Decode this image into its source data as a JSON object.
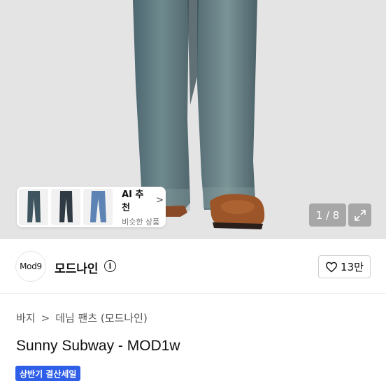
{
  "hero": {
    "image_desc_icon": "jeans-photo",
    "counter": "1 / 8"
  },
  "ai_card": {
    "title": "AI 추천",
    "subtitle": "비슷한 상품",
    "chevron": ">"
  },
  "shop": {
    "logo_text": "Mod9",
    "name": "모드나인",
    "info_glyph": "i",
    "likes": "13만"
  },
  "breadcrumb": {
    "items": [
      "바지",
      "데님 팬츠 (모드나인)"
    ],
    "separator": ">"
  },
  "product": {
    "title": "Sunny Subway - MOD1w",
    "badge": "상반기 결산세일"
  },
  "colors": {
    "badge_bg": "#2f5fe8",
    "hero_bg": "#e4e4e5"
  }
}
